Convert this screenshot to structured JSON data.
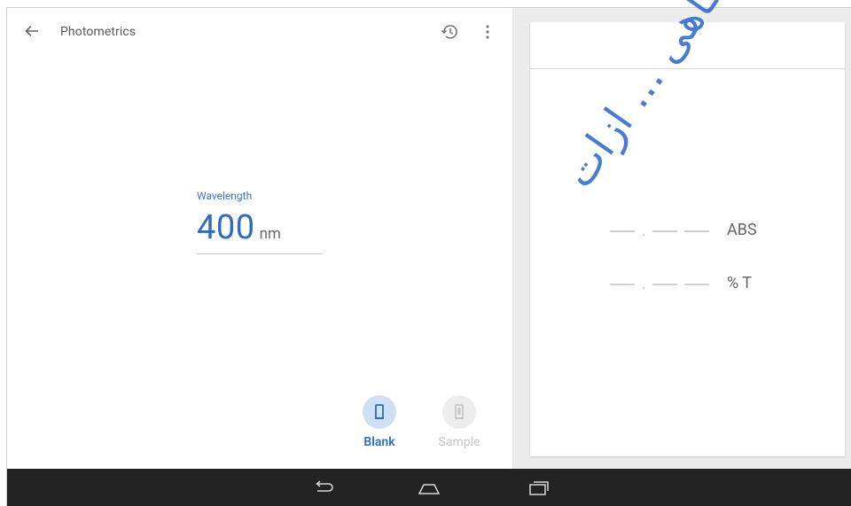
{
  "app": {
    "title": "Photometrics"
  },
  "icons": {
    "back": "arrow-back-icon",
    "history": "history-icon",
    "more": "more-vert-icon",
    "blank": "cuvette-icon",
    "sample": "cuvette-sample-icon",
    "nav_back": "nav-back-icon",
    "nav_home": "nav-home-icon",
    "nav_recent": "nav-recents-icon"
  },
  "wavelength": {
    "label": "Wavelength",
    "value": "400",
    "unit": "nm"
  },
  "modes": {
    "blank_label": "Blank",
    "sample_label": "Sample",
    "selected": "Blank"
  },
  "readings": {
    "abs_unit": "ABS",
    "t_unit": "% T"
  },
  "watermark": {
    "text": "ازمایشگاهی ... ازات"
  },
  "colors": {
    "accent": "#2f6cc0",
    "accent_light": "#cfe0f4",
    "navbar": "#232323",
    "panel_bg": "#ececec"
  }
}
